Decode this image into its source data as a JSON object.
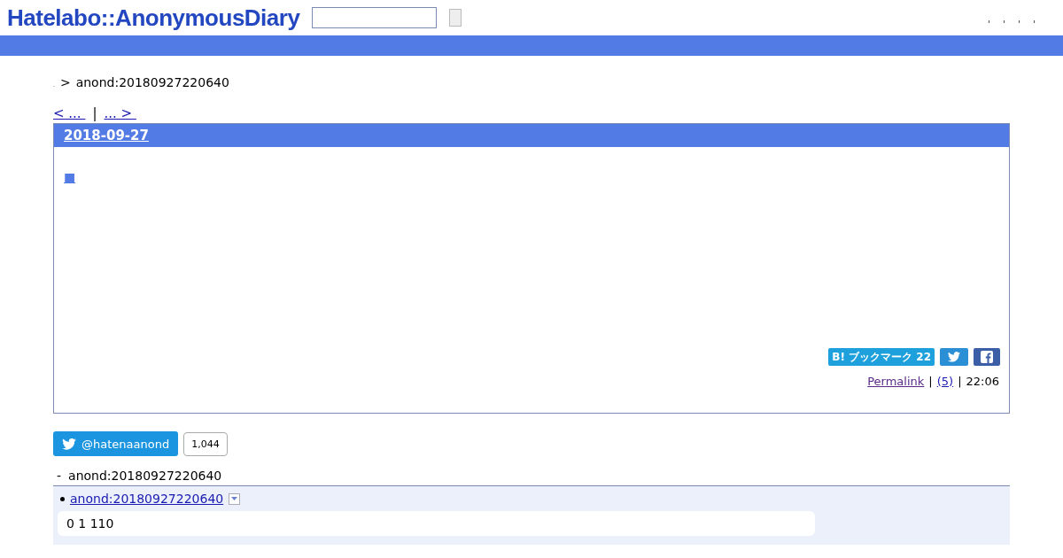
{
  "header": {
    "logo": "Hatelabo::AnonymousDiary"
  },
  "breadcrumb": {
    "home": ".",
    "separator": ">",
    "current": "anond:20180927220640"
  },
  "pager": {
    "prev": "< ... ",
    "divider": "|",
    "next": "... > "
  },
  "entry": {
    "date": "2018-09-27",
    "mark": "■",
    "bookmark_mark": "B!",
    "bookmark": "ブックマーク 22",
    "footer": {
      "permalink": "Permalink",
      "sep1": "|",
      "comments": "(5)",
      "sep2": "|",
      "time": "22:06"
    }
  },
  "twitter": {
    "handle": "@hatenaanond",
    "count": "1,044"
  },
  "refs": {
    "dash": "-",
    "title": "anond:20180927220640",
    "items": [
      {
        "link": "anond:20180927220640",
        "text": "0 1 110"
      }
    ]
  }
}
